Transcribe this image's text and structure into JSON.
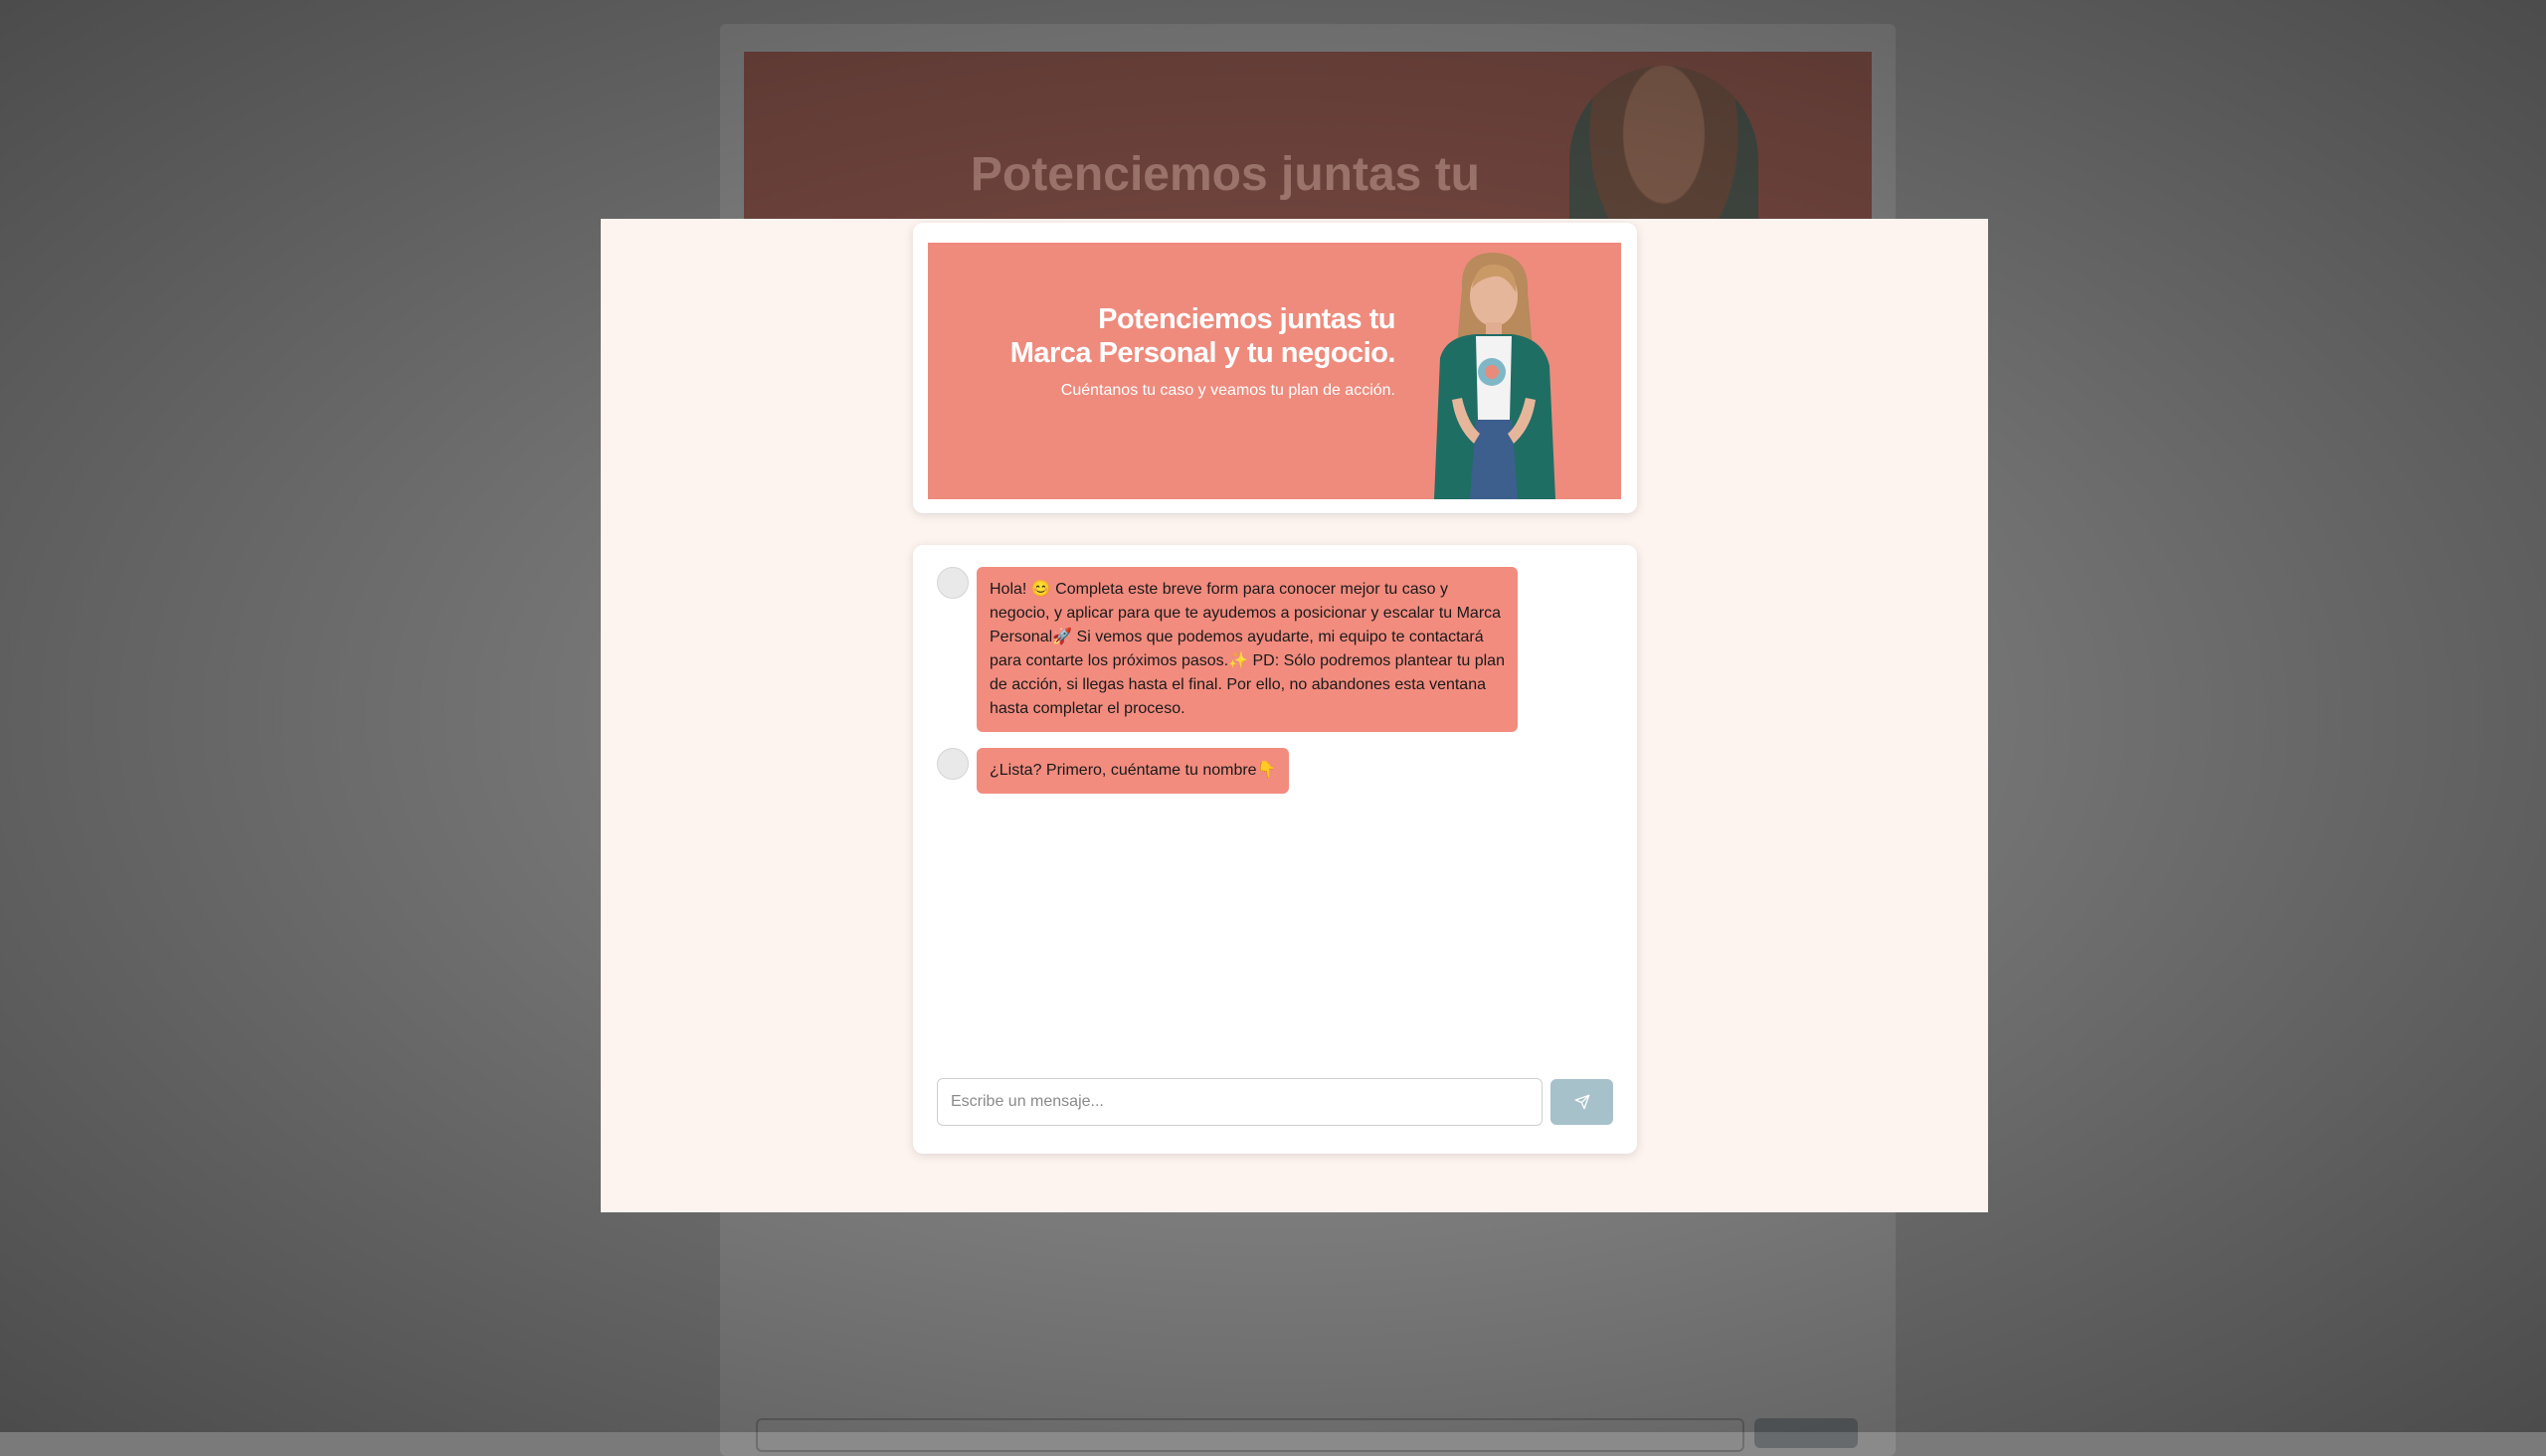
{
  "banner": {
    "title_line1": "Potenciemos juntas tu",
    "title_line2": "Marca Personal y tu negocio.",
    "subtitle": "Cuéntanos tu caso y veamos tu plan de acción."
  },
  "chat": {
    "messages": [
      {
        "text": "Hola! 😊 Completa este breve form para conocer mejor tu caso y negocio, y aplicar para que te ayudemos a posicionar y escalar tu Marca Personal🚀 Si vemos que podemos ayudarte, mi equipo te contactará para contarte los próximos pasos.✨ PD: Sólo podremos plantear tu plan de acción, si llegas hasta el final. Por ello, no abandones esta ventana hasta completar el proceso."
      },
      {
        "text": "¿Lista? Primero, cuéntame tu nombre👇"
      }
    ],
    "input_placeholder": "Escribe un mensaje...",
    "send_icon": "send-icon"
  },
  "colors": {
    "accent": "#f28c7f",
    "banner_bg": "#ee8b7d",
    "modal_bg": "#fdf3ef",
    "send_button": "#a7c1cb"
  }
}
